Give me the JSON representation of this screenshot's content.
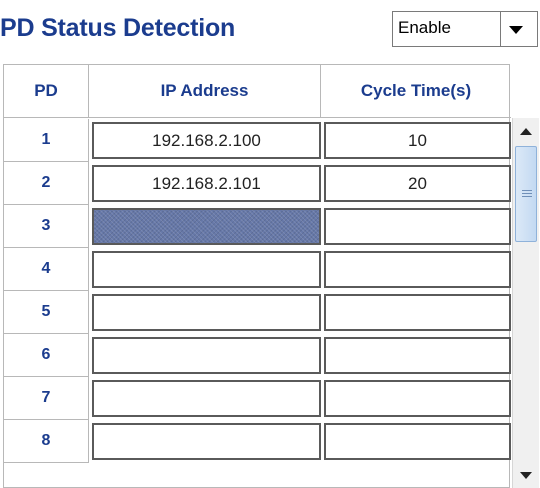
{
  "title": "PD Status Detection",
  "status_select": {
    "value": "Enable"
  },
  "table": {
    "headers": [
      "PD",
      "IP Address",
      "Cycle Time(s)"
    ],
    "rows": [
      {
        "pd": "1",
        "ip": "192.168.2.100",
        "cycle": "10"
      },
      {
        "pd": "2",
        "ip": "192.168.2.101",
        "cycle": "20"
      },
      {
        "pd": "3",
        "ip": "",
        "cycle": ""
      },
      {
        "pd": "4",
        "ip": "",
        "cycle": ""
      },
      {
        "pd": "5",
        "ip": "",
        "cycle": ""
      },
      {
        "pd": "6",
        "ip": "",
        "cycle": ""
      },
      {
        "pd": "7",
        "ip": "",
        "cycle": ""
      },
      {
        "pd": "8",
        "ip": "",
        "cycle": ""
      }
    ]
  },
  "colors": {
    "label_blue": "#1b3c8e",
    "selected_field": "#6678a8"
  },
  "icons": [
    "chevron-down-icon",
    "scroll-up-icon",
    "scroll-down-icon"
  ]
}
